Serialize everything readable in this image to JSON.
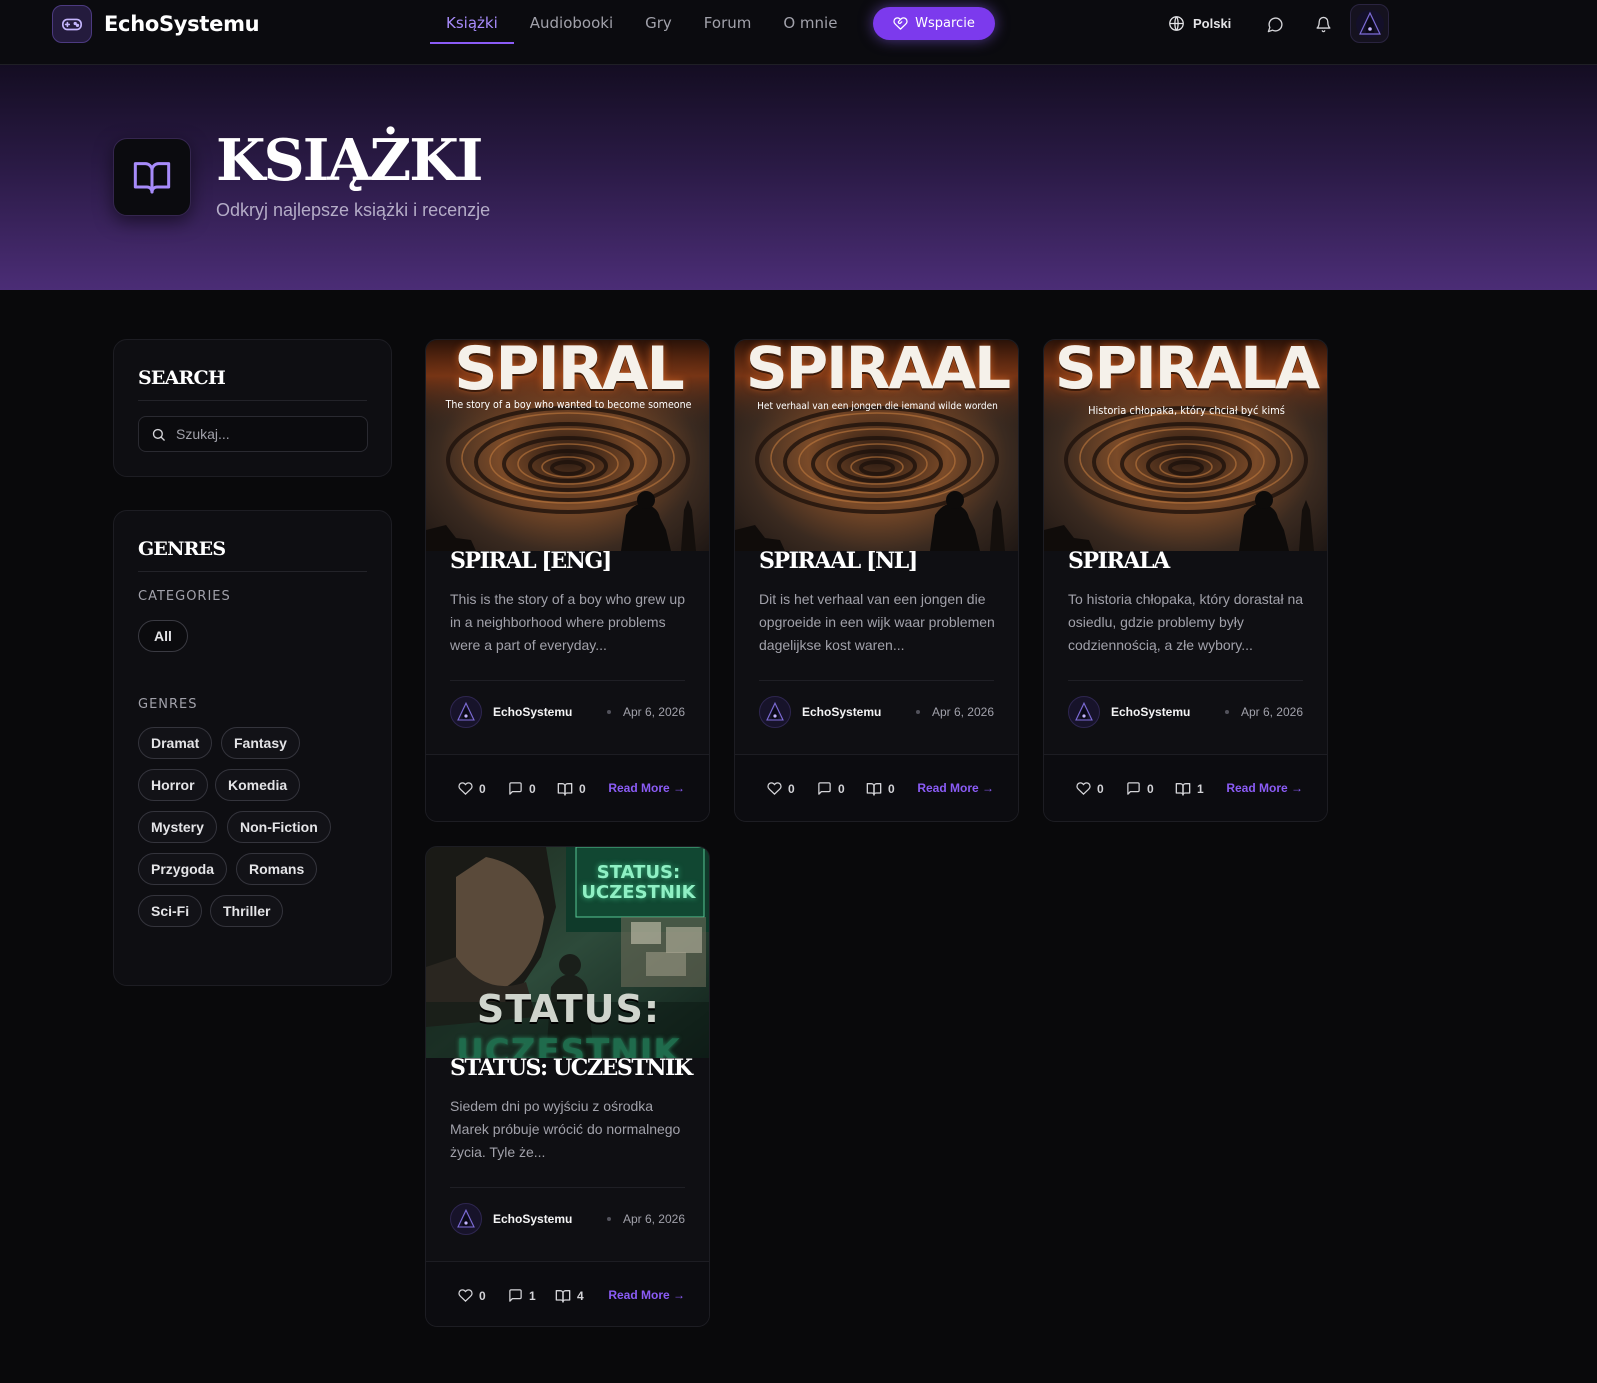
{
  "nav": {
    "brand": "EchoSystemu",
    "links": [
      "Książki",
      "Audiobooki",
      "Gry",
      "Forum",
      "O mnie"
    ],
    "support_label": "Wsparcie",
    "language": "Polski"
  },
  "hero": {
    "title": "KSIĄŻKI",
    "subtitle": "Odkryj najlepsze książki i recenzje"
  },
  "sidebar": {
    "search_title": "SEARCH",
    "search_placeholder": "Szukaj...",
    "genres_title": "GENRES",
    "categories_label": "CATEGORIES",
    "categories": [
      "All"
    ],
    "genres_label": "GENRES",
    "genres": [
      "Dramat",
      "Fantasy",
      "Horror",
      "Komedia",
      "Mystery",
      "Non-Fiction",
      "Przygoda",
      "Romans",
      "Sci-Fi",
      "Thriller"
    ]
  },
  "books": [
    {
      "cover_title": "SPIRAL",
      "cover_subtitle": "The story of a boy who wanted to become someone",
      "title": "SPIRAL [ENG]",
      "description": "This is the story of a boy who grew up in a neighborhood where problems were a part of everyday...",
      "author": "EchoSystemu",
      "date": "Apr 6, 2026",
      "likes": "0",
      "comments": "0",
      "reads": "0",
      "read_more": "Read More →"
    },
    {
      "cover_title": "SPIRAAL",
      "cover_subtitle": "Het verhaal van een jongen die iemand wilde worden",
      "title": "SPIRAAL [NL]",
      "description": "Dit is het verhaal van een jongen die opgroeide in een wijk waar problemen dagelijkse kost waren...",
      "author": "EchoSystemu",
      "date": "Apr 6, 2026",
      "likes": "0",
      "comments": "0",
      "reads": "0",
      "read_more": "Read More →"
    },
    {
      "cover_title": "SPIRALA",
      "cover_subtitle": "Historia chłopaka, który chciał być kimś",
      "title": "SPIRALA",
      "description": "To historia chłopaka, który dorastał na osiedlu, gdzie problemy były codziennością, a złe wybory...",
      "author": "EchoSystemu",
      "date": "Apr 6, 2026",
      "likes": "0",
      "comments": "0",
      "reads": "1",
      "read_more": "Read More →"
    },
    {
      "cover_title": "STATUS:",
      "cover_title2": "UCZESTNIK",
      "cover_sign": "STATUS: UCZESTNIK",
      "title": "STATUS: UCZESTNIK",
      "description": "Siedem dni po wyjściu z ośrodka Marek próbuje wrócić do normalnego życia. Tyle że...",
      "author": "EchoSystemu",
      "date": "Apr 6, 2026",
      "likes": "0",
      "comments": "1",
      "reads": "4",
      "read_more": "Read More →"
    }
  ],
  "colors": {
    "accent": "#8b5cf6",
    "background": "#09090b",
    "card": "#0f0f13"
  }
}
